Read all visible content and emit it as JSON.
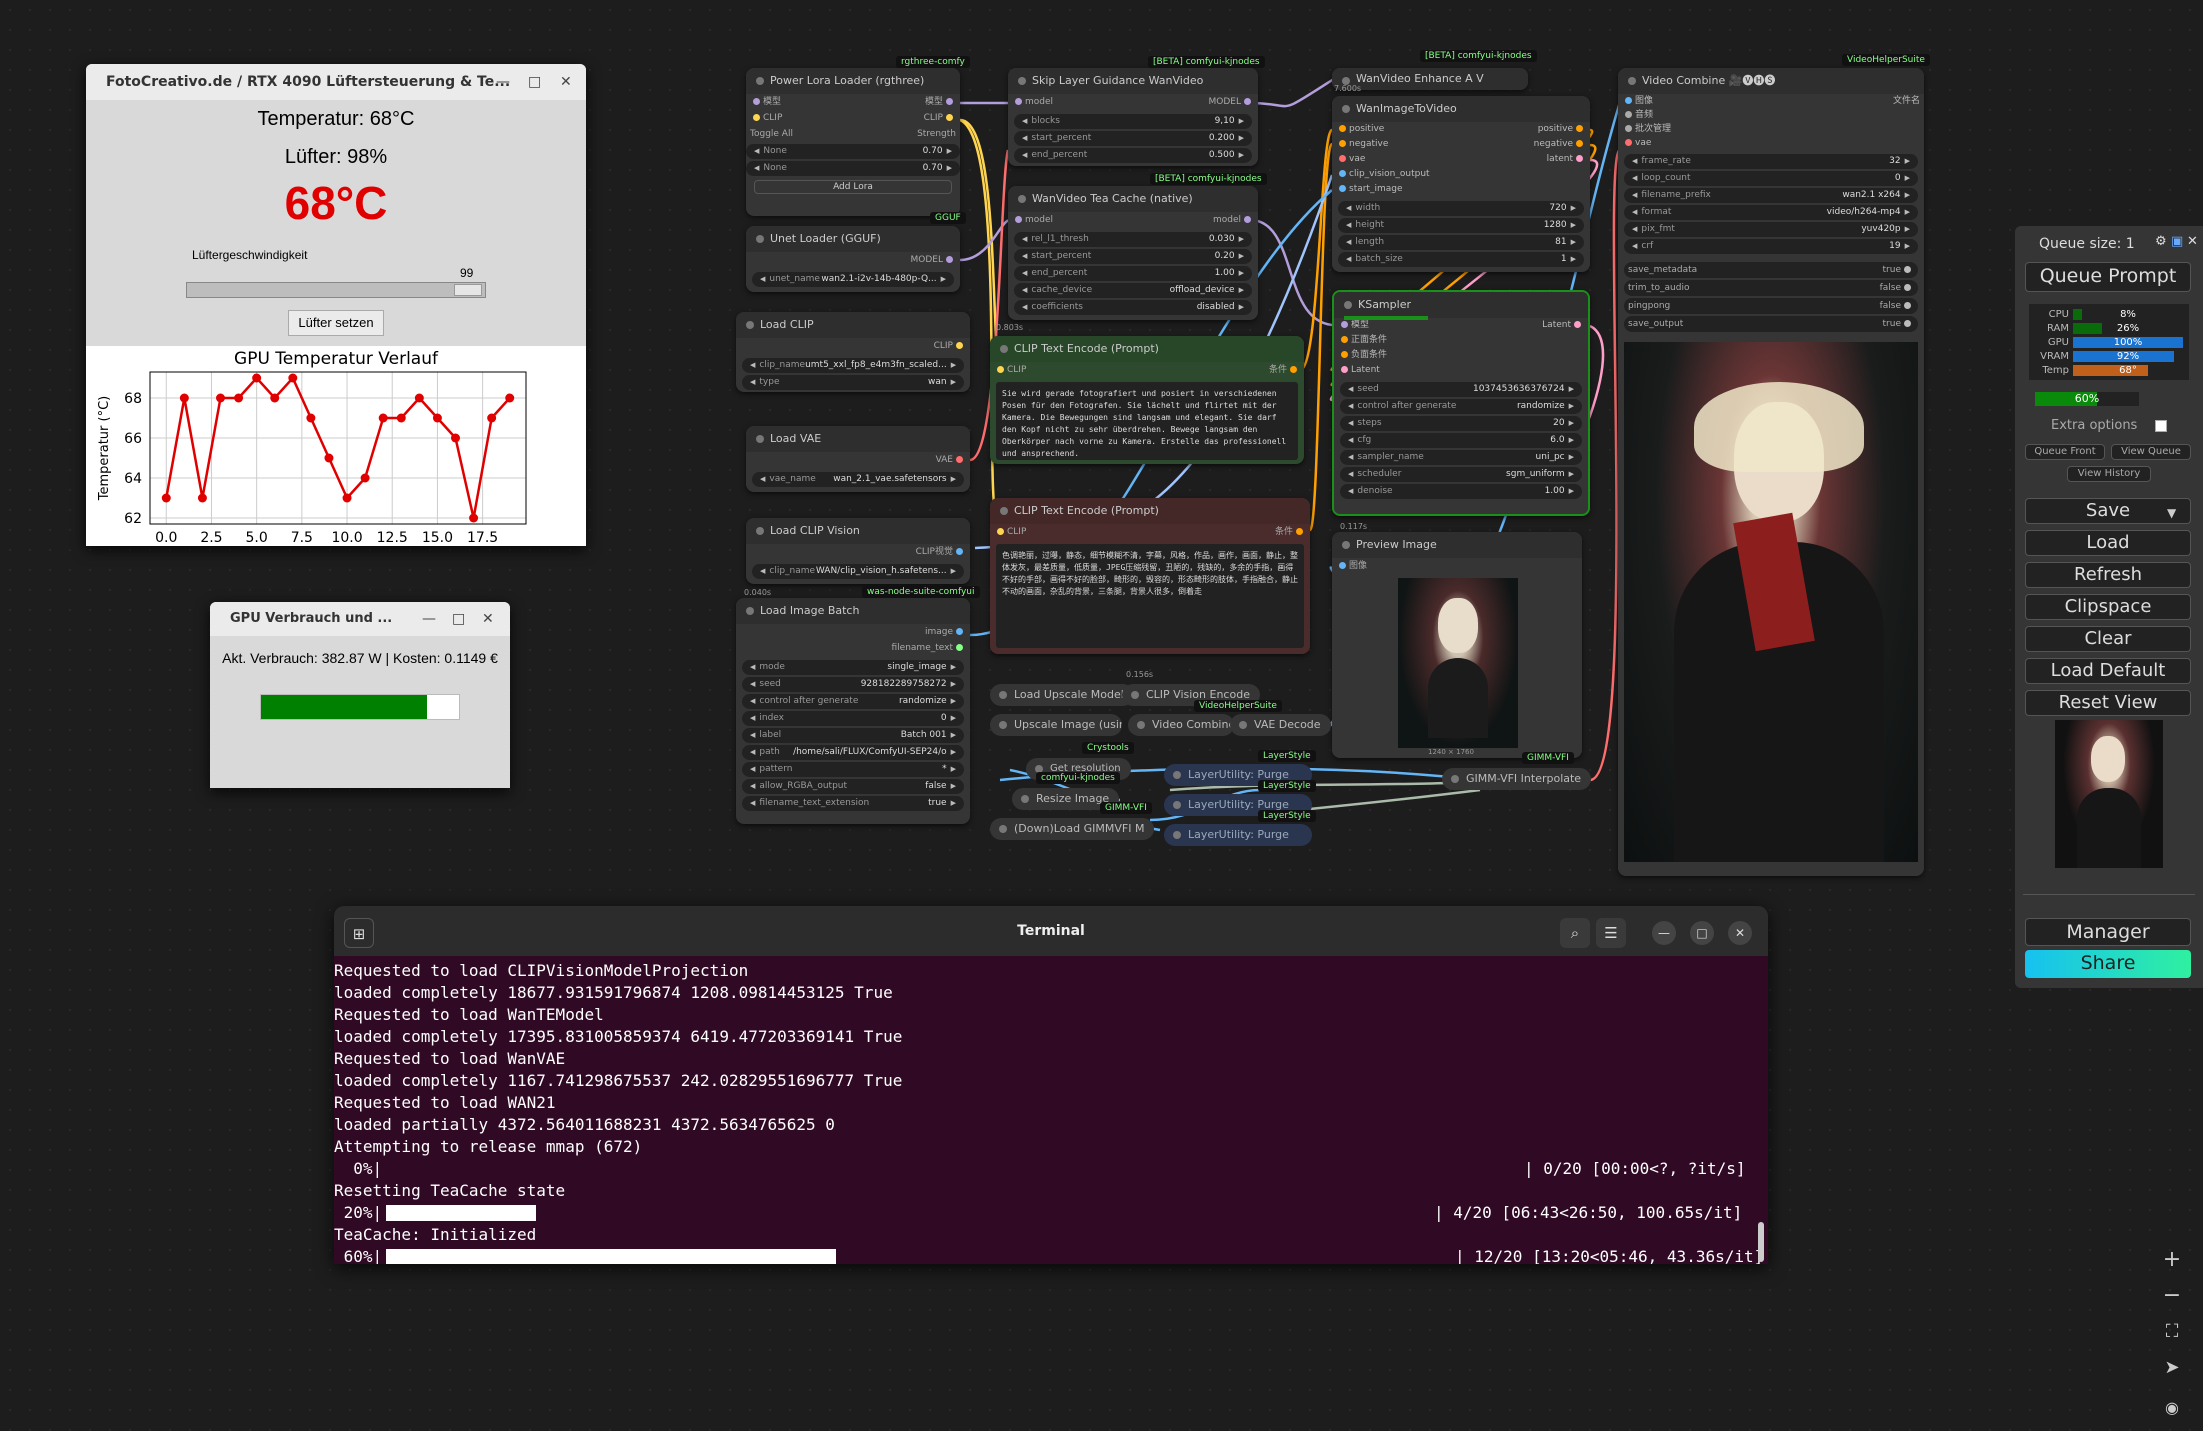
{
  "fan_window": {
    "title": "FotoCreativo.de / RTX 4090 Lüftersteuerung & Te...",
    "temp_label": "Temperatur: 68°C",
    "fan_label": "Lüfter: 98%",
    "temp_big": "68°C",
    "speed_label": "Lüftergeschwindigkeit",
    "slider_value": "99",
    "slider_fraction": 0.99,
    "set_button": "Lüfter setzen",
    "red": "#e00000"
  },
  "chart_data": {
    "type": "line",
    "title": "GPU Temperatur Verlauf",
    "xlabel": "",
    "ylabel": "Temperatur (°C)",
    "x": [
      0,
      1,
      2,
      3,
      4,
      5,
      6,
      7,
      8,
      9,
      10,
      11,
      12,
      13,
      14,
      15,
      16,
      17,
      18,
      19
    ],
    "y": [
      63,
      68,
      63,
      68,
      68,
      69,
      68,
      69,
      67,
      65,
      63,
      64,
      67,
      67,
      68,
      67,
      66,
      62,
      67,
      68
    ],
    "xlim": [
      -0.9,
      19.9
    ],
    "ylim": [
      61.7,
      69.3
    ],
    "xticks": [
      "0.0",
      "2.5",
      "5.0",
      "7.5",
      "10.0",
      "12.5",
      "15.0",
      "17.5"
    ],
    "xtick_values": [
      0,
      2.5,
      5,
      7.5,
      10,
      12.5,
      15,
      17.5
    ],
    "yticks": [
      "62",
      "64",
      "66",
      "68"
    ],
    "ytick_values": [
      62,
      64,
      66,
      68
    ],
    "color": "#e00000"
  },
  "power_window": {
    "title": "GPU Verbrauch und ...",
    "text": "Akt. Verbrauch: 382.87 W | Kosten: 0.1149 €",
    "bar_fraction": 0.84,
    "bar_color": "#008000"
  },
  "nodes": {
    "power_lora": {
      "title": "Power Lora Loader (rgthree)",
      "tag": "rgthree-comfy",
      "in1": "模型",
      "in2": "CLIP",
      "out1": "模型",
      "out2": "CLIP",
      "toggle": "Toggle All",
      "strength": "Strength",
      "none1": "None",
      "v1": "0.70",
      "none2": "None",
      "v2": "0.70",
      "add": "Add Lora"
    },
    "skip_layer": {
      "title": "Skip Layer Guidance WanVideo",
      "tag": "[BETA] comfyui-kjnodes",
      "in": "model",
      "out": "MODEL",
      "w": [
        [
          "blocks",
          "9,10"
        ],
        [
          "start_percent",
          "0.200"
        ],
        [
          "end_percent",
          "0.500"
        ]
      ]
    },
    "tea_cache": {
      "title": "WanVideo Tea Cache (native)",
      "tag": "[BETA] comfyui-kjnodes",
      "in": "model",
      "out": "model",
      "w": [
        [
          "rel_l1_thresh",
          "0.030"
        ],
        [
          "start_percent",
          "0.20"
        ],
        [
          "end_percent",
          "1.00"
        ],
        [
          "cache_device",
          "offload_device"
        ],
        [
          "coefficients",
          "disabled"
        ]
      ],
      "timer": "0.803s"
    },
    "unet": {
      "title": "Unet Loader (GGUF)",
      "tag": "GGUF",
      "out": "MODEL",
      "w": [
        [
          "unet_name",
          "wan2.1-i2v-14b-480p-Q..."
        ]
      ]
    },
    "load_clip": {
      "title": "Load CLIP",
      "out": "CLIP",
      "w": [
        [
          "clip_name",
          "umt5_xxl_fp8_e4m3fn_scaled..."
        ],
        [
          "type",
          "wan"
        ]
      ]
    },
    "load_vae": {
      "title": "Load VAE",
      "out": "VAE",
      "w": [
        [
          "vae_name",
          "wan_2.1_vae.safetensors"
        ]
      ]
    },
    "load_clip_vision": {
      "title": "Load CLIP Vision",
      "out": "CLIP视觉",
      "w": [
        [
          "clip_name",
          "WAN/clip_vision_h.safetens..."
        ]
      ],
      "timer": "0.040s"
    },
    "image_batch": {
      "title": "Load Image Batch",
      "tag": "was-node-suite-comfyui",
      "out1": "image",
      "out2": "filename_text",
      "w": [
        [
          "mode",
          "single_image"
        ],
        [
          "seed",
          "928182289758272"
        ],
        [
          "control after generate",
          "randomize"
        ],
        [
          "index",
          "0"
        ],
        [
          "label",
          "Batch 001"
        ],
        [
          "path",
          "/home/sali/FLUX/ComfyUI-SEP24/o"
        ],
        [
          "pattern",
          "*"
        ],
        [
          "allow_RGBA_output",
          "false"
        ],
        [
          "filename_text_extension",
          "true"
        ]
      ]
    },
    "clip_pos": {
      "title": "CLIP Text Encode (Prompt)",
      "in": "CLIP",
      "out": "条件",
      "text": "Sie wird gerade fotografiert und posiert in verschiedenen Posen für den Fotografen. Sie lächelt und flirtet mit der Kamera. Die Bewegungen sind langsam und elegant. Sie darf den Kopf nicht zu sehr überdrehen. Bewege langsam den Oberkörper nach vorne zu Kamera. Erstelle das professionell und ansprechend."
    },
    "clip_neg": {
      "title": "CLIP Text Encode (Prompt)",
      "in": "CLIP",
      "out": "条件",
      "text": "色调艳丽，过曝，静态，细节模糊不清，字幕，风格，作品，画作，画面，静止，整体发灰，最差质量，低质量，JPEG压缩残留，丑陋的，残缺的，多余的手指，画得不好的手部，画得不好的脸部，畸形的，毁容的，形态畸形的肢体，手指融合，静止不动的画面，杂乱的背景，三条腿，背景人很多，倒着走"
    },
    "wan_enhance": {
      "title": "WanVideo Enhance A V",
      "tag": "[BETA] comfyui-kjnodes",
      "timer": "7.600s"
    },
    "wan_i2v": {
      "title": "WanImageToVideo",
      "in": [
        "positive",
        "negative",
        "vae",
        "clip_vision_output",
        "start_image"
      ],
      "out": [
        "positive",
        "negative",
        "latent"
      ],
      "w": [
        [
          "width",
          "720"
        ],
        [
          "height",
          "1280"
        ],
        [
          "length",
          "81"
        ],
        [
          "batch_size",
          "1"
        ]
      ]
    },
    "ksampler": {
      "title": "KSampler",
      "in": [
        "模型",
        "正面条件",
        "负面条件",
        "Latent"
      ],
      "out": "Latent",
      "w": [
        [
          "seed",
          "1037453636376724"
        ],
        [
          "control after generate",
          "randomize"
        ],
        [
          "steps",
          "20"
        ],
        [
          "cfg",
          "6.0"
        ],
        [
          "sampler_name",
          "uni_pc"
        ],
        [
          "scheduler",
          "sgm_uniform"
        ],
        [
          "denoise",
          "1.00"
        ]
      ],
      "progress": 0.6,
      "timer": "0.117s"
    },
    "preview": {
      "title": "Preview Image",
      "in": "图像",
      "size": "1240 × 1760"
    },
    "video_combine": {
      "title": "Video Combine 🎥🅥🅗🅢",
      "tag": "VideoHelperSuite",
      "in": [
        "图像",
        "音频",
        "批次管理",
        "vae"
      ],
      "out": "文件名",
      "w": [
        [
          "frame_rate",
          "32"
        ],
        [
          "loop_count",
          "0"
        ],
        [
          "filename_prefix",
          "wan2.1 x264"
        ],
        [
          "format",
          "video/h264-mp4"
        ],
        [
          "pix_fmt",
          "yuv420p"
        ],
        [
          "crf",
          "19"
        ]
      ],
      "toggles": [
        [
          "save_metadata",
          "true"
        ],
        [
          "trim_to_audio",
          "false"
        ],
        [
          "pingpong",
          "false"
        ],
        [
          "save_output",
          "true"
        ]
      ]
    },
    "mini": {
      "load_upscale": "Load Upscale Model",
      "clip_vision_enc": "CLIP Vision Encode",
      "timer2": "0.156s",
      "upscale": "Upscale Image (using",
      "vc2": "Video Combine 🎥🅥🅗🅢",
      "vae_decode": "VAE Decode",
      "vhs_tag": "VideoHelperSuite",
      "crystools": "Crystools",
      "get_res": "Get resolution",
      "kj_tag": "comfyui-kjnodes",
      "resize": "Resize Image",
      "gimm_tag": "GIMM-VFI",
      "down_gimm": "(Down)Load GIMMVFI M",
      "lu1": "LayerUtility: Purge",
      "lu2": "LayerUtility: Purge",
      "lu3": "LayerUtility: Purge",
      "ls1": "LayerStyle",
      "ls2": "LayerStyle",
      "ls3": "LayerStyle",
      "gimm_interp": "GIMM-VFI Interpolate",
      "gimm_tag2": "GIMM-VFI"
    }
  },
  "sidebar": {
    "queue_size": "Queue size: 1",
    "queue_prompt": "Queue Prompt",
    "stats": [
      {
        "label": "CPU",
        "value": "8%",
        "fraction": 0.08,
        "color": "#0a6b0a"
      },
      {
        "label": "RAM",
        "value": "26%",
        "fraction": 0.26,
        "color": "#0a6b0a"
      },
      {
        "label": "GPU",
        "value": "100%",
        "fraction": 1.0,
        "color": "#1a73d0"
      },
      {
        "label": "VRAM",
        "value": "92%",
        "fraction": 0.92,
        "color": "#1a73d0"
      },
      {
        "label": "Temp",
        "value": "68°",
        "fraction": 0.68,
        "color": "#c0601a"
      }
    ],
    "progress": "60%",
    "progress_fraction": 0.6,
    "extra_options": "Extra options",
    "queue_front": "Queue Front",
    "view_queue": "View Queue",
    "view_history": "View History",
    "buttons": [
      "Save",
      "Load",
      "Refresh",
      "Clipspace",
      "Clear",
      "Load Default",
      "Reset View"
    ],
    "manager": "Manager",
    "share": "Share"
  },
  "terminal": {
    "title": "Terminal",
    "lines": [
      "Requested to load CLIPVisionModelProjection",
      "loaded completely 18677.931591796874 1208.09814453125 True",
      "Requested to load WanTEModel",
      "loaded completely 17395.831005859374 6419.477203369141 True",
      "Requested to load WanVAE",
      "loaded completely 1167.741298675537 242.02829551696777 True",
      "Requested to load WAN21",
      "loaded partially 4372.564011688231 4372.5634765625 0",
      "Attempting to release mmap (672)"
    ],
    "p0_pct": "  0%|",
    "p0_stat": "| 0/20 [00:00<?, ?it/s]",
    "reset": "Resetting TeaCache state",
    "p1_pct": " 20%|",
    "p1_stat": "| 4/20 [06:43<26:50, 100.65s/it]",
    "p1_fraction": 0.2,
    "init": "TeaCache: Initialized",
    "p2_pct": " 60%|",
    "p2_stat": "| 12/20 [13:20<05:46, 43.36s/it]",
    "p2_fraction": 0.6
  }
}
